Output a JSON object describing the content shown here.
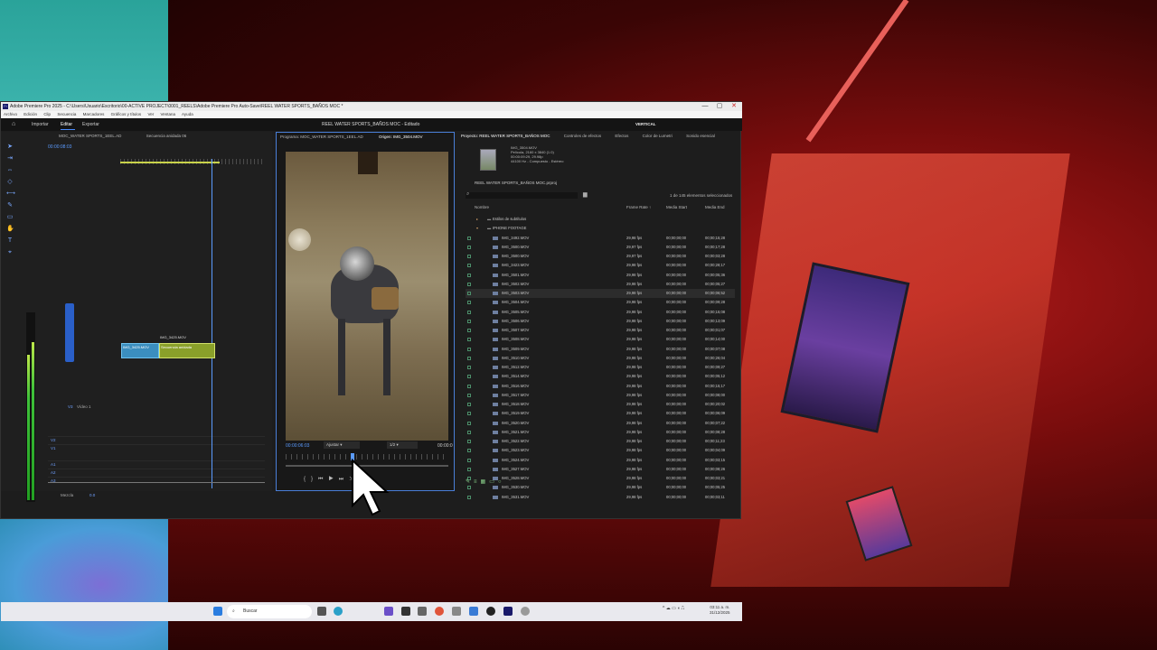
{
  "window": {
    "title": "Adobe Premiere Pro 2025 - C:\\Users\\Usuario\\Escritorio\\00-ACTIVE PROJECT\\0001_REELS\\Adobe Premiere Pro Auto-Save\\REEL WATER SPORTS_BAÑOS MOC *",
    "minimize": "—",
    "maximize": "▢",
    "close": "✕"
  },
  "menu": [
    "Archivo",
    "Edición",
    "Clip",
    "Secuencia",
    "Marcadores",
    "Gráficos y títulos",
    "Ver",
    "Ventana",
    "Ayuda"
  ],
  "workspace": {
    "tabs": [
      "Importar",
      "Editar",
      "Exportar"
    ],
    "active_tab": "Editar",
    "project_title": "REEL WATER SPORTS_BAÑOS MOC - Editado",
    "layout_label": "VERTICAL"
  },
  "timeline": {
    "tabs": [
      "MOC_WATER SPORTS_1EEL.AD",
      "Secuencia anidada 06"
    ],
    "timecode": "00:00:08:03",
    "track_labels": [
      "V3",
      "V2",
      "V1",
      "A1",
      "A2",
      "A3",
      "Mezcla"
    ],
    "video_track_name": "Vídeo 1",
    "mix_value": "0.0",
    "clip_label_top": "IMG_3425.MOV",
    "clip_a": "IMG_3425.MOV",
    "clip_b": "Secuencia anidada"
  },
  "program": {
    "tabs": [
      "Programa: MOC_WATER SPORTS_1EEL.AD",
      "Origen: IMG_3504.MOV"
    ],
    "timecode": "00:00:06:03",
    "fit": "Ajustar",
    "resolution": "1/2",
    "timecode_right": "00:00:0"
  },
  "project": {
    "tabs": [
      "Proyecto: REEL WATER SPORTS_BAÑOS MOC",
      "Controles de efectos",
      "Efectos",
      "Color de Lumetri",
      "Sonido esencial"
    ],
    "clip_name": "IMG_3504.MOV",
    "clip_meta": [
      "Película, 2160 x 3840 (1.0)",
      "00:00:09:29, 29.98p",
      "44100 Hz - Compuesto - Estéreo"
    ],
    "project_file": "REEL WATER SPORTS_BAÑOS MOC.prproj",
    "selection_count": "1 de 145 elementos seleccionados",
    "columns": {
      "name": "Nombre",
      "frame_rate": "Frame Rate ↑",
      "media_start": "Media Start",
      "media_end": "Media End"
    },
    "folders": [
      "Estilos de subtítulos",
      "IPHONE FOOTAGE"
    ],
    "files": [
      {
        "name": "IMG_3492.MOV",
        "fr": "29,98 fps",
        "ms": "00;00;00;00",
        "me": "00;00;15;28"
      },
      {
        "name": "IMG_3500.MOV",
        "fr": "29,97 fps",
        "ms": "00;00;00;00",
        "me": "00;00;17;28"
      },
      {
        "name": "IMG_3500.MOV",
        "fr": "29,97 fps",
        "ms": "00;00;00;00",
        "me": "00;00;03;28"
      },
      {
        "name": "IMG_3423.MOV",
        "fr": "29,98 fps",
        "ms": "00;00;00;00",
        "me": "00;00;28;17"
      },
      {
        "name": "IMG_3501.MOV",
        "fr": "29,98 fps",
        "ms": "00;00;00;00",
        "me": "00;00;05;36"
      },
      {
        "name": "IMG_3502.MOV",
        "fr": "29,98 fps",
        "ms": "00;00;00;00",
        "me": "00;00;05;27"
      },
      {
        "name": "IMG_3503.MOV",
        "fr": "29,98 fps",
        "ms": "00;00;00;00",
        "me": "00;00;06;52"
      },
      {
        "name": "IMG_3504.MOV",
        "fr": "29,98 fps",
        "ms": "00;00;00;00",
        "me": "00;00;09;28"
      },
      {
        "name": "IMG_3505.MOV",
        "fr": "29,98 fps",
        "ms": "00;00;00;00",
        "me": "00;00;15;08"
      },
      {
        "name": "IMG_3506.MOV",
        "fr": "29,98 fps",
        "ms": "00;00;00;00",
        "me": "00;00;13;09"
      },
      {
        "name": "IMG_3507.MOV",
        "fr": "29,98 fps",
        "ms": "00;00;00;00",
        "me": "00;00;01;07"
      },
      {
        "name": "IMG_3508.MOV",
        "fr": "29,98 fps",
        "ms": "00;00;00;00",
        "me": "00;00;14;00"
      },
      {
        "name": "IMG_3509.MOV",
        "fr": "29,98 fps",
        "ms": "00;00;00;00",
        "me": "00;00;07;08"
      },
      {
        "name": "IMG_3510.MOV",
        "fr": "29,98 fps",
        "ms": "00;00;00;00",
        "me": "00;00;26;04"
      },
      {
        "name": "IMG_3512.MOV",
        "fr": "29,98 fps",
        "ms": "00;00;00;00",
        "me": "00;00;09;27"
      },
      {
        "name": "IMG_3514.MOV",
        "fr": "29,98 fps",
        "ms": "00;00;00;00",
        "me": "00;00;05;12"
      },
      {
        "name": "IMG_3516.MOV",
        "fr": "29,98 fps",
        "ms": "00;00;00;00",
        "me": "00;00;15;17"
      },
      {
        "name": "IMG_3517.MOV",
        "fr": "29,98 fps",
        "ms": "00;00;00;00",
        "me": "00;00;08;00"
      },
      {
        "name": "IMG_3518.MOV",
        "fr": "29,98 fps",
        "ms": "00;00;00;00",
        "me": "00;00;20;02"
      },
      {
        "name": "IMG_3519.MOV",
        "fr": "29,98 fps",
        "ms": "00;00;00;00",
        "me": "00;00;06;09"
      },
      {
        "name": "IMG_3520.MOV",
        "fr": "29,98 fps",
        "ms": "00;00;00;00",
        "me": "00;00;07;22"
      },
      {
        "name": "IMG_3521.MOV",
        "fr": "29,98 fps",
        "ms": "00;00;00;00",
        "me": "00;00;08;28"
      },
      {
        "name": "IMG_3522.MOV",
        "fr": "29,98 fps",
        "ms": "00;00;00;00",
        "me": "00;00;11;23"
      },
      {
        "name": "IMG_3523.MOV",
        "fr": "29,98 fps",
        "ms": "00;00;00;00",
        "me": "00;00;04;09"
      },
      {
        "name": "IMG_3524.MOV",
        "fr": "29,98 fps",
        "ms": "00;00;00;00",
        "me": "00;00;03;15"
      },
      {
        "name": "IMG_3527.MOV",
        "fr": "29,98 fps",
        "ms": "00;00;00;00",
        "me": "00;00;08;26"
      },
      {
        "name": "IMG_3528.MOV",
        "fr": "29,98 fps",
        "ms": "00;00;00;00",
        "me": "00;00;03;21"
      },
      {
        "name": "IMG_3530.MOV",
        "fr": "29,98 fps",
        "ms": "00;00;00;00",
        "me": "00;00;05;25"
      },
      {
        "name": "IMG_3531.MOV",
        "fr": "29,98 fps",
        "ms": "00;00;00;00",
        "me": "00;00;03;11"
      }
    ]
  },
  "taskbar": {
    "search_placeholder": "Buscar",
    "time": "03:11 a. m.",
    "date": "31/12/2025",
    "tray": "^ ☁ ▭ ◖ ⎍"
  },
  "colors": {
    "accent_blue": "#4a8cff",
    "video_clip": "#3b8ebf",
    "nested_clip": "#8aa02a",
    "meter_green": "#3fc23a"
  },
  "audio_meter": {
    "left_level": 0.78,
    "right_level": 0.85
  }
}
